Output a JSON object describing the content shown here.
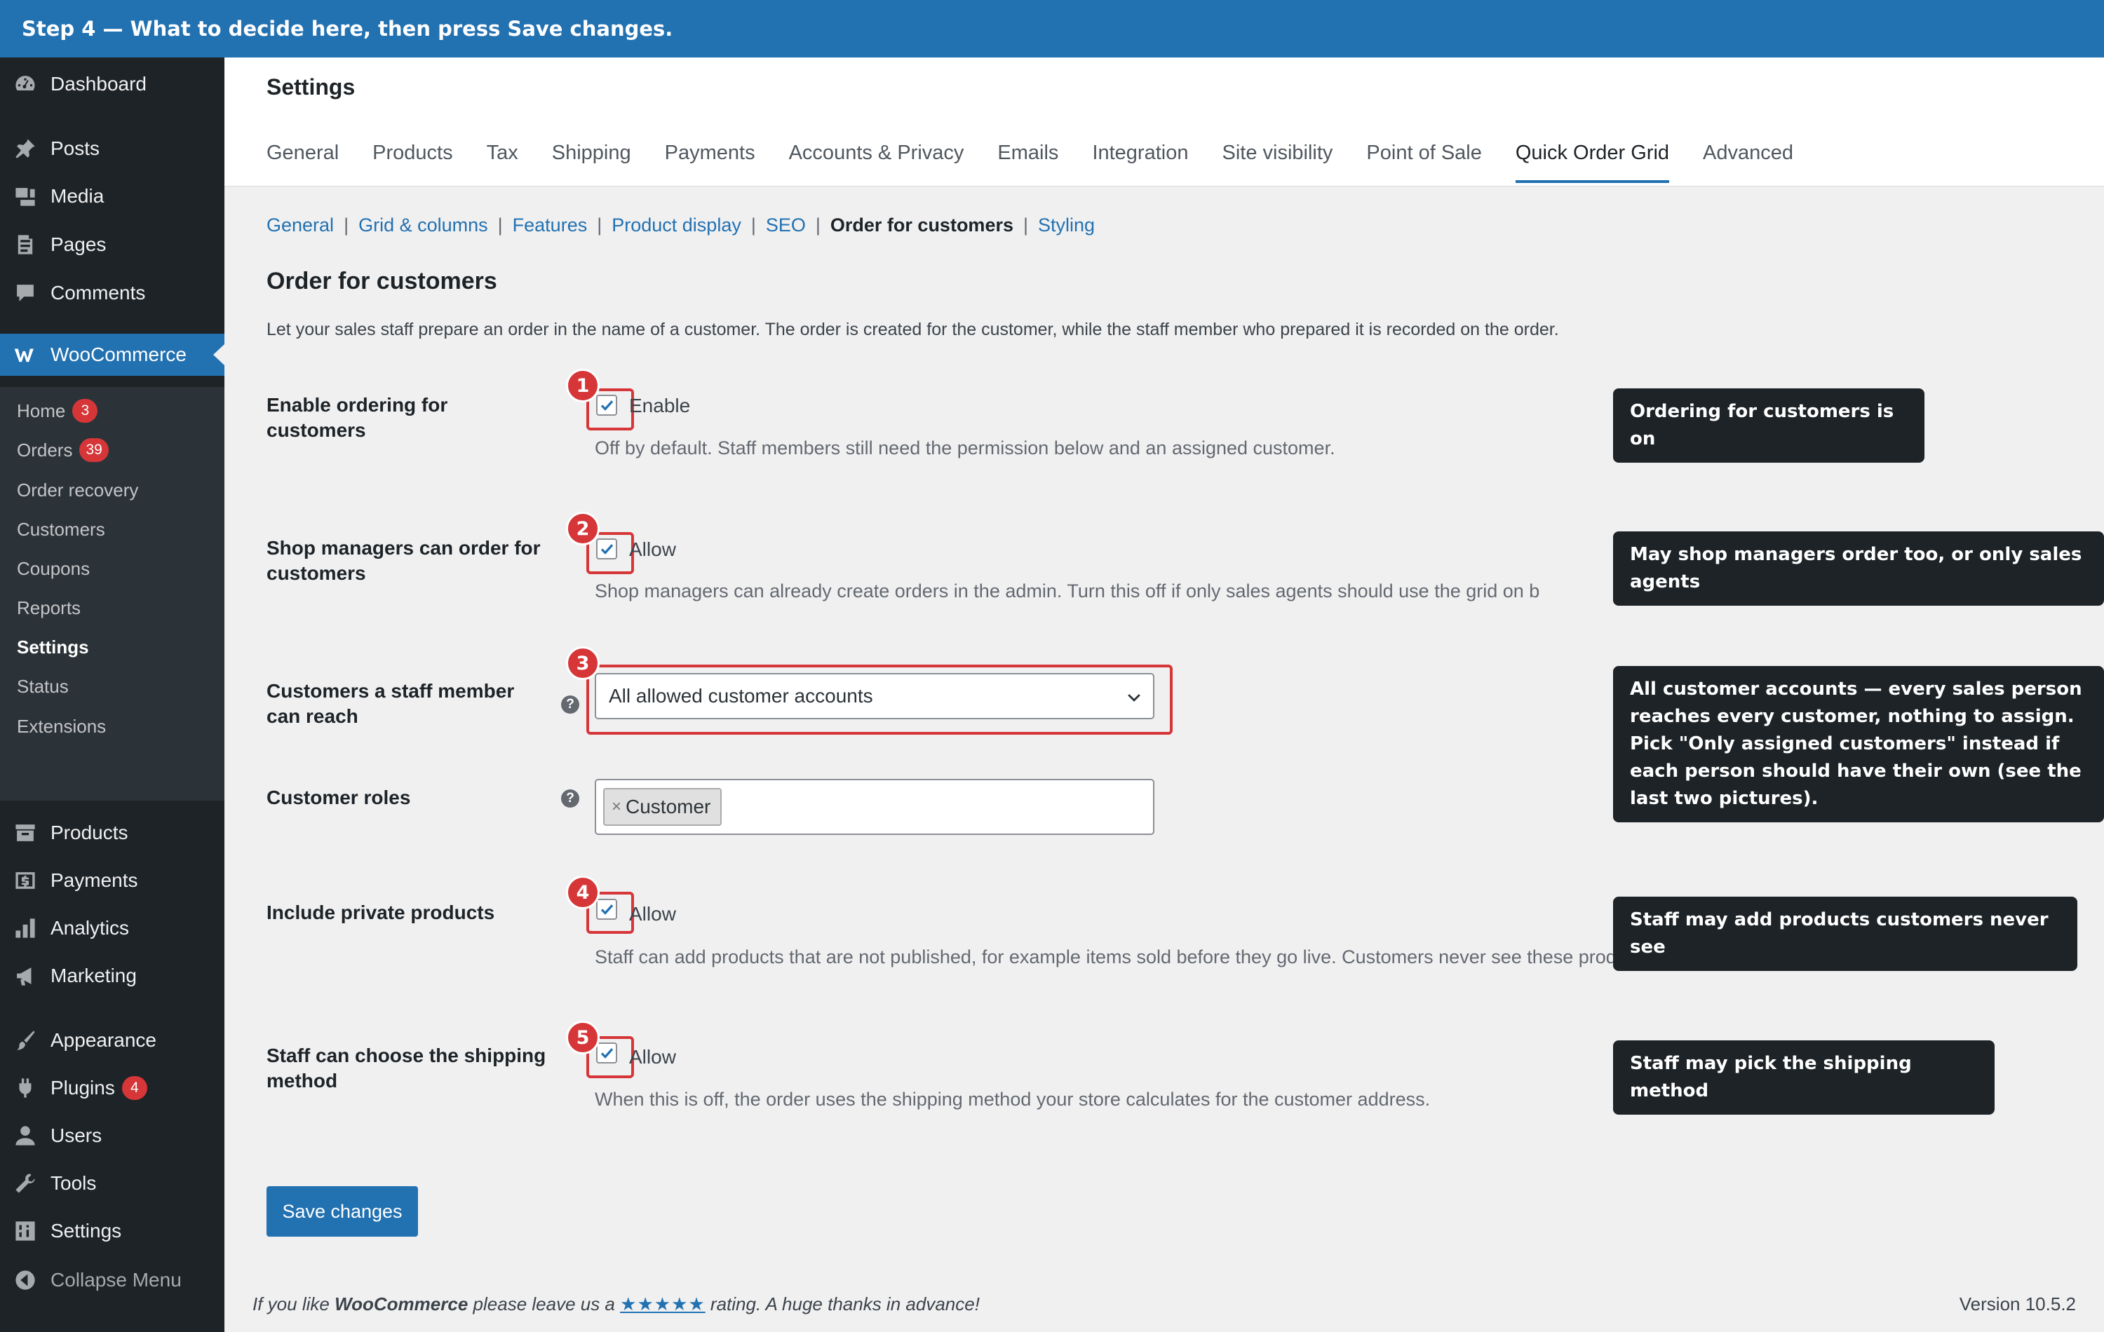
{
  "banner": {
    "text": "Step 4 — What to decide here, then press Save changes."
  },
  "sidebar": {
    "top_items": [
      {
        "label": "Dashboard",
        "icon": "dashboard-icon"
      },
      {
        "label": "Posts",
        "icon": "pin-icon"
      },
      {
        "label": "Media",
        "icon": "media-icon"
      },
      {
        "label": "Pages",
        "icon": "pages-icon"
      },
      {
        "label": "Comments",
        "icon": "comment-icon"
      },
      {
        "label": "WooCommerce",
        "icon": "woocommerce-icon"
      }
    ],
    "woo_submenu": [
      {
        "label": "Home",
        "badge": "3"
      },
      {
        "label": "Orders",
        "badge": "39"
      },
      {
        "label": "Order recovery"
      },
      {
        "label": "Customers"
      },
      {
        "label": "Coupons"
      },
      {
        "label": "Reports"
      },
      {
        "label": "Settings"
      },
      {
        "label": "Status"
      },
      {
        "label": "Extensions"
      }
    ],
    "bottom_items": [
      {
        "label": "Products",
        "icon": "archive-icon"
      },
      {
        "label": "Payments",
        "icon": "payments-icon"
      },
      {
        "label": "Analytics",
        "icon": "analytics-icon"
      },
      {
        "label": "Marketing",
        "icon": "megaphone-icon"
      },
      {
        "label": "Appearance",
        "icon": "brush-icon"
      },
      {
        "label": "Plugins",
        "icon": "plugin-icon",
        "badge": "4"
      },
      {
        "label": "Users",
        "icon": "user-icon"
      },
      {
        "label": "Tools",
        "icon": "wrench-icon"
      },
      {
        "label": "Settings",
        "icon": "settings-icon"
      },
      {
        "label": "Collapse Menu",
        "icon": "collapse-icon"
      }
    ]
  },
  "header": {
    "title": "Settings",
    "tabs": [
      "General",
      "Products",
      "Tax",
      "Shipping",
      "Payments",
      "Accounts & Privacy",
      "Emails",
      "Integration",
      "Site visibility",
      "Point of Sale",
      "Quick Order Grid",
      "Advanced"
    ],
    "active_tab": "Quick Order Grid"
  },
  "subnav": {
    "items": [
      "General",
      "Grid & columns",
      "Features",
      "Product display",
      "SEO",
      "Order for customers",
      "Styling"
    ],
    "current": "Order for customers"
  },
  "section": {
    "title": "Order for customers",
    "description": "Let your sales staff prepare an order in the name of a customer. The order is created for the customer, while the staff member who prepared it is recorded on the order."
  },
  "settings": {
    "enable_ordering": {
      "label": "Enable ordering for customers",
      "checkbox_label": "Enable",
      "checked": true,
      "step": "1",
      "description": "Off by default. Staff members still need the permission below and an assigned customer."
    },
    "shop_managers": {
      "label": "Shop managers can order for customers",
      "checkbox_label": "Allow",
      "checked": true,
      "step": "2",
      "description": "Shop managers can already create orders in the admin. Turn this off if only sales agents should use the grid on b"
    },
    "customers_reach": {
      "label": "Customers a staff member can reach",
      "value": "All allowed customer accounts",
      "step": "3"
    },
    "customer_roles": {
      "label": "Customer roles",
      "chips": [
        "Customer"
      ]
    },
    "private_products": {
      "label": "Include private products",
      "checkbox_label": "Allow",
      "checked": true,
      "step": "4",
      "description": "Staff can add products that are not published, for example items sold before they go live. Customers never see these products in their own grid."
    },
    "shipping_method": {
      "label": "Staff can choose the shipping method",
      "checkbox_label": "Allow",
      "checked": true,
      "step": "5",
      "description": "When this is off, the order uses the shipping method your store calculates for the customer address."
    }
  },
  "callouts": {
    "c1": "Ordering for customers is on",
    "c2": "May shop managers order too, or only sales agents",
    "c3": "All customer accounts — every sales person reaches every customer, nothing to assign. Pick \"Only assigned customers\" instead if each person should have their own (see the last two pictures).",
    "c4": "Staff may add products customers never see",
    "c5": "Staff may pick the shipping method"
  },
  "save_button": "Save changes",
  "footer": {
    "prefix": "If you like",
    "brand": "WooCommerce",
    "middle": "please leave us a",
    "stars": "★★★★★",
    "suffix": "rating. A huge thanks in advance!",
    "version": "Version 10.5.2"
  },
  "colors": {
    "accent": "#2271b1",
    "sidebar": "#1d2327",
    "highlight_red": "#d63638"
  }
}
